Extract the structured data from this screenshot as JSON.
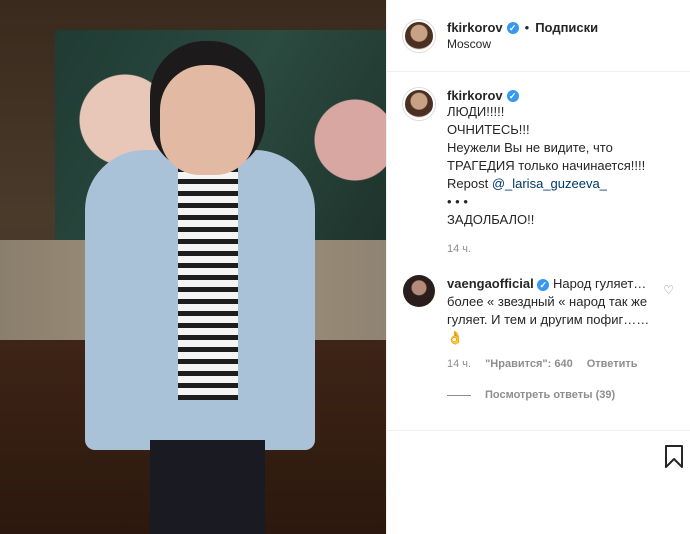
{
  "header": {
    "username": "fkirkorov",
    "dot": "•",
    "follow_label": "Подписки",
    "location": "Moscow"
  },
  "caption": {
    "username": "fkirkorov",
    "lines": [
      "ЛЮДИ!!!!!",
      "ОЧНИТЕСЬ!!!",
      "Неужели Вы не видите, что",
      "ТРАГЕДИЯ только начинается!!!!",
      "Repost ",
      "•  •  •",
      "ЗАДОЛБАЛО!!"
    ],
    "mention": "@_larisa_guzeeva_",
    "time": "14 ч."
  },
  "comment": {
    "username": "vaengaofficial",
    "text": "Народ гуляет… более « звездный « народ так же гуляет. И тем и другим пофиг……👌",
    "time": "14 ч.",
    "likes": "\"Нравится\": 640",
    "reply_label": "Ответить",
    "view_replies": "Посмотреть ответы (39)"
  },
  "icons": {
    "verified": "verified-badge-icon",
    "heart": "heart-icon",
    "bookmark": "bookmark-icon"
  },
  "colors": {
    "verified": "#3897f0",
    "muted": "#8e8e8e",
    "link": "#00376b"
  }
}
